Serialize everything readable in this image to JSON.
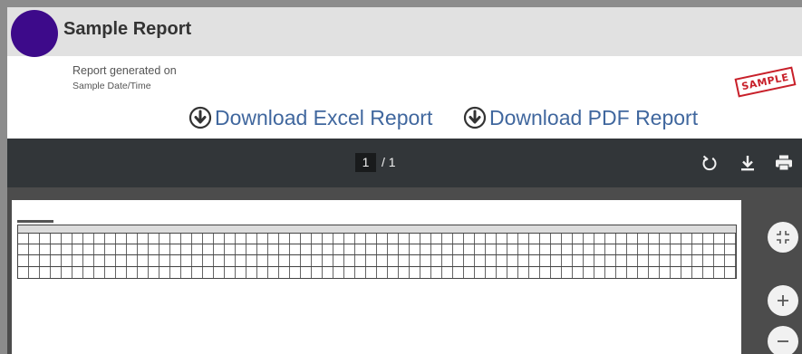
{
  "header": {
    "title": "Sample Report",
    "logo_icon": "round-logo",
    "logo_color": "#3d0a8a"
  },
  "report": {
    "generated_label": "Report generated on",
    "generated_value": "Sample Date/Time",
    "stamp_text": "SAMPLE"
  },
  "downloads": {
    "excel_label": "Download Excel Report",
    "pdf_label": "Download PDF Report",
    "icon": "download-circle-icon",
    "link_color": "#40679e"
  },
  "pdf_viewer": {
    "current_page": "1",
    "total_pages": "/ 1",
    "toolbar_icons": [
      "rotate-icon",
      "download-icon",
      "print-icon"
    ],
    "side_controls": [
      "fit-page-icon",
      "zoom-in-icon",
      "zoom-out-icon"
    ]
  }
}
